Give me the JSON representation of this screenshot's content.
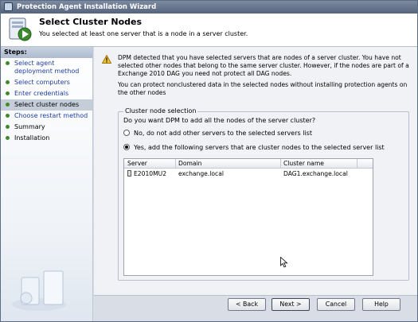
{
  "window": {
    "title": "Protection Agent Installation Wizard"
  },
  "header": {
    "title": "Select Cluster Nodes",
    "subtitle": "You selected at least one server that is a node in a server cluster."
  },
  "sidebar": {
    "heading": "Steps:",
    "items": [
      {
        "label": "Select agent deployment method",
        "state": "link"
      },
      {
        "label": "Select computers",
        "state": "link"
      },
      {
        "label": "Enter credentials",
        "state": "link"
      },
      {
        "label": "Select cluster nodes",
        "state": "current"
      },
      {
        "label": "Choose restart method",
        "state": "link"
      },
      {
        "label": "Summary",
        "state": "plain"
      },
      {
        "label": "Installation",
        "state": "plain"
      }
    ]
  },
  "content": {
    "paragraph1": "DPM detected that you have selected servers that are nodes of a server cluster. You have not selected other nodes that belong to the same server cluster. However, if the nodes are part of a Exchange 2010 DAG  you need not protect all DAG nodes.",
    "paragraph2": "You can protect nonclustered data in the selected nodes without installing protection agents on the other nodes",
    "group": {
      "legend": "Cluster node selection",
      "question": "Do you want DPM to add all the nodes of  the server cluster?",
      "options": [
        {
          "label": "No, do not add other servers to the selected servers list",
          "selected": false
        },
        {
          "label": "Yes, add the following servers that are cluster nodes to the selected server list",
          "selected": true
        }
      ]
    },
    "table": {
      "columns": [
        "Server",
        "Domain",
        "Cluster name"
      ],
      "rows": [
        {
          "server": "E2010MU2",
          "domain": "exchange.local",
          "cluster": "DAG1.exchange.local"
        }
      ]
    }
  },
  "footer": {
    "back": "< Back",
    "next": "Next >",
    "cancel": "Cancel",
    "help": "Help"
  },
  "colors": {
    "link": "#1f3f9f",
    "titlebar": "#55647d",
    "step_dot": "#3f8a2b"
  }
}
